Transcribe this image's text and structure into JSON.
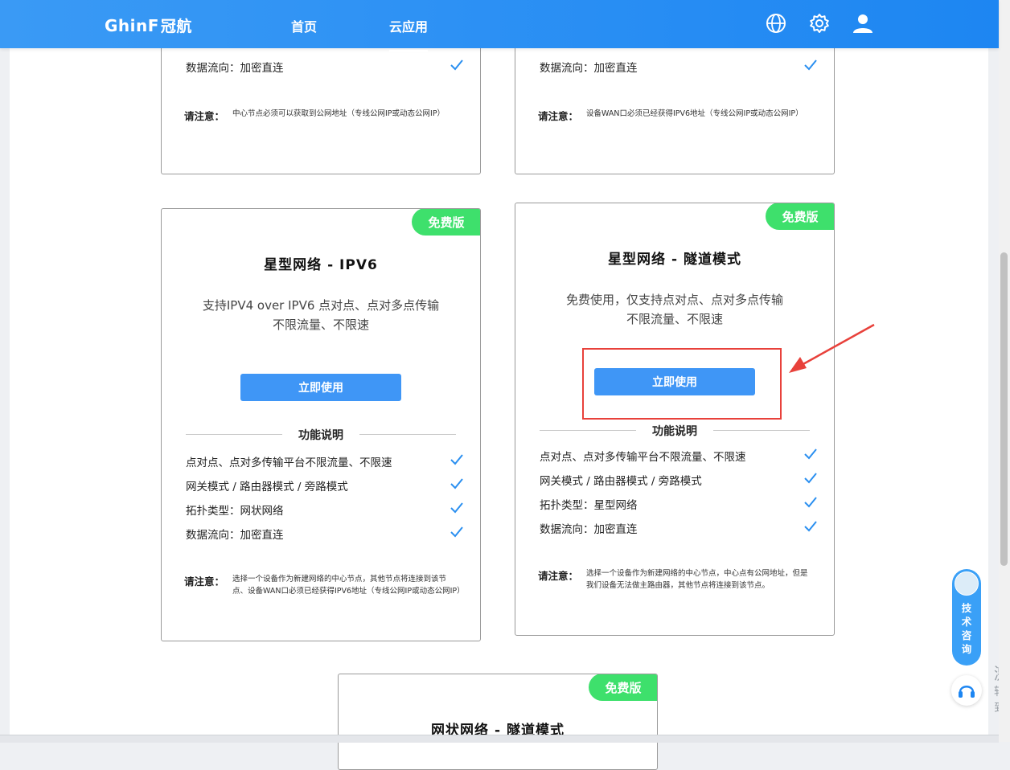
{
  "nav": {
    "logo_text": "GhinF",
    "logo_cn": "冠航",
    "links": [
      {
        "label": "首页",
        "active": false
      },
      {
        "label": "云应用",
        "active": true
      }
    ],
    "icons": [
      "globe-icon",
      "gear-icon",
      "user-icon"
    ]
  },
  "cards": {
    "top_left": {
      "features": [
        {
          "label": "数据流向：加密直连",
          "checked": true
        }
      ],
      "note_label": "请注意：",
      "note_text": "中心节点必须可以获取到公网地址（专线公网IP或动态公网IP）"
    },
    "top_right": {
      "features": [
        {
          "label": "数据流向：加密直连",
          "checked": true
        }
      ],
      "note_label": "请注意：",
      "note_text": "设备WAN口必须已经获得IPV6地址（专线公网IP或动态公网IP）"
    },
    "star_ipv6": {
      "badge": "免费版",
      "title": "星型网络 - IPV6",
      "desc_line1": "支持IPV4 over IPV6 点对点、点对多点传输",
      "desc_line2": "不限流量、不限速",
      "button": "立即使用",
      "func_header": "功能说明",
      "features": [
        {
          "label": "点对点、点对多传输平台不限流量、不限速",
          "checked": true
        },
        {
          "label": "网关模式 / 路由器模式 / 旁路模式",
          "checked": true
        },
        {
          "label": "拓扑类型：网状网络",
          "checked": true
        },
        {
          "label": "数据流向：加密直连",
          "checked": true
        }
      ],
      "note_label": "请注意：",
      "note_text": "选择一个设备作为新建网络的中心节点，其他节点将连接到该节点、设备WAN口必须已经获得IPV6地址（专线公网IP或动态公网IP）"
    },
    "star_tunnel": {
      "badge": "免费版",
      "title": "星型网络 - 隧道模式",
      "desc_line1": "免费使用，仅支持点对点、点对多点传输",
      "desc_line2": "不限流量、不限速",
      "button": "立即使用",
      "func_header": "功能说明",
      "features": [
        {
          "label": "点对点、点对多传输平台不限流量、不限速",
          "checked": true
        },
        {
          "label": "网关模式 / 路由器模式 / 旁路模式",
          "checked": true
        },
        {
          "label": "拓扑类型：星型网络",
          "checked": true
        },
        {
          "label": "数据流向：加密直连",
          "checked": true
        }
      ],
      "note_label": "请注意：",
      "note_text": "选择一个设备作为新建网络的中心节点，中心点有公网地址，但是我们设备无法做主路由器，其他节点将连接到该节点。"
    },
    "mesh_tunnel": {
      "badge": "免费版",
      "title": "网状网络 - 隧道模式"
    }
  },
  "float": {
    "consult_label": "技术咨询"
  },
  "edge_text": {
    "line1": "激",
    "line2": "转到"
  },
  "colors": {
    "nav_blue": "#1d86f2",
    "button_blue": "#3f96f6",
    "badge_green": "#3ee06c",
    "check_blue": "#2a8ff0",
    "highlight_red": "#e8413b"
  }
}
